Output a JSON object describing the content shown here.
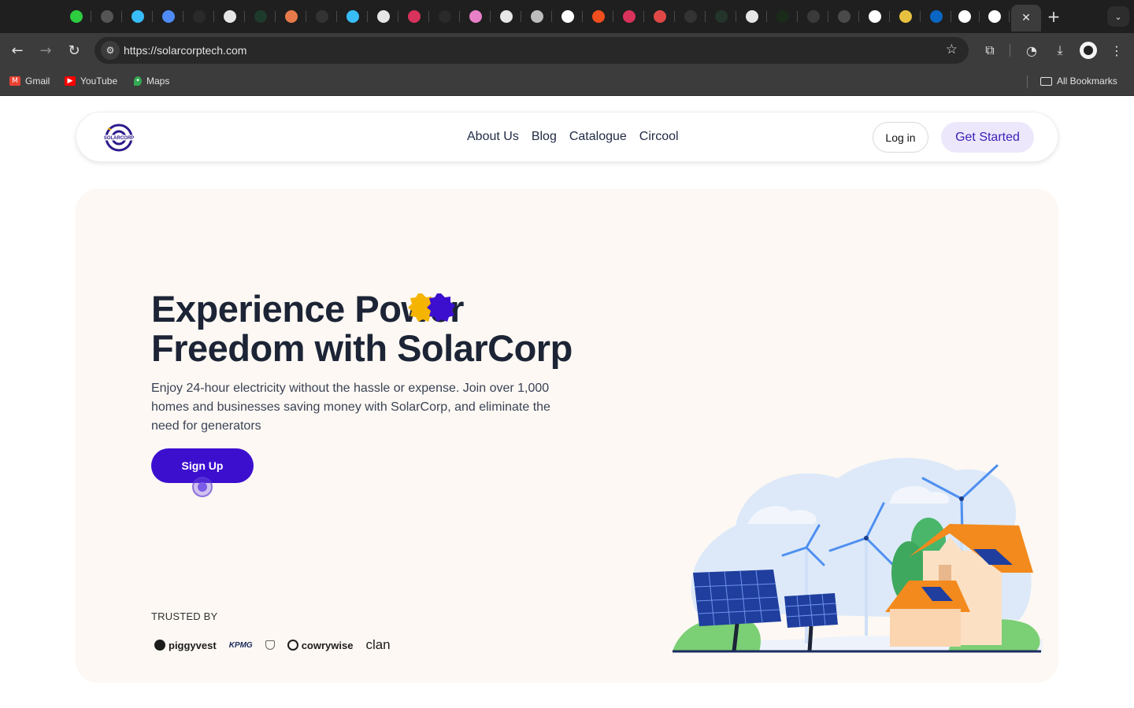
{
  "browser": {
    "tabs": [
      {
        "icon": "green-circle-icon",
        "color": "#2ecc40"
      },
      {
        "icon": "slash-circle-icon",
        "color": "#555555"
      },
      {
        "icon": "tailwind-icon",
        "color": "#38bdf8"
      },
      {
        "icon": "sparkle-icon",
        "color": "#4f8cf7"
      },
      {
        "icon": "blank-tab-icon",
        "color": "#2a2a2a"
      },
      {
        "icon": "openai-icon",
        "color": "#e6e6e6"
      },
      {
        "icon": "cursor-app-icon",
        "color": "#1e3a2a"
      },
      {
        "icon": "claude-icon",
        "color": "#e67a4a"
      },
      {
        "icon": "slash-icon",
        "color": "#333333"
      },
      {
        "icon": "tailwind-icon",
        "color": "#38bdf8"
      },
      {
        "icon": "openai-icon",
        "color": "#e6e6e6"
      },
      {
        "icon": "debian-icon",
        "color": "#d7335c"
      },
      {
        "icon": "blank-tab-icon",
        "color": "#2a2a2a"
      },
      {
        "icon": "gradient-app-icon",
        "color": "#e880c8"
      },
      {
        "icon": "github-icon",
        "color": "#e6e6e6"
      },
      {
        "icon": "openai-icon",
        "color": "#bdbdbd"
      },
      {
        "icon": "google-icon",
        "color": "#ffffff"
      },
      {
        "icon": "figma-icon",
        "color": "#f24e1e"
      },
      {
        "icon": "debian-icon",
        "color": "#d7335c"
      },
      {
        "icon": "zb-icon",
        "color": "#e04848"
      },
      {
        "icon": "slash-icon",
        "color": "#333333"
      },
      {
        "icon": "blank-tab-icon",
        "color": "#23352b"
      },
      {
        "icon": "github-icon",
        "color": "#e6e6e6"
      },
      {
        "icon": "check-icon",
        "color": "#1a2b1a"
      },
      {
        "icon": "mlr-icon",
        "color": "#3a3a3a"
      },
      {
        "icon": "dots-icon",
        "color": "#4a4a4a"
      },
      {
        "icon": "avatar-tab-icon",
        "color": "#ffffff"
      },
      {
        "icon": "colorful-icon",
        "color": "#e8c040"
      },
      {
        "icon": "linkedin-icon",
        "color": "#0a66c2"
      },
      {
        "icon": "google-icon",
        "color": "#ffffff"
      },
      {
        "icon": "google-icon",
        "color": "#ffffff"
      }
    ],
    "active_tab_close": "✕",
    "new_tab": "+",
    "url": "https://solarcorptech.com",
    "bookmarks": [
      {
        "label": "Gmail",
        "icon": "gmail-icon",
        "color": "#ea4335"
      },
      {
        "label": "YouTube",
        "icon": "youtube-icon",
        "color": "#ff0000"
      },
      {
        "label": "Maps",
        "icon": "maps-icon",
        "color": "#34a853"
      }
    ],
    "all_bookmarks": "All Bookmarks"
  },
  "site": {
    "logo_text": "SOLARCORP",
    "nav": [
      "About Us",
      "Blog",
      "Catalogue",
      "Circool"
    ],
    "login": "Log in",
    "get_started": "Get Started",
    "headline_line1": "Experience Power",
    "headline_line2": "Freedom with SolarCorp",
    "subtext": "Enjoy 24-hour electricity without the hassle or expense. Join over 1,000 homes and businesses saving money with SolarCorp, and eliminate the need for generators",
    "signup": "Sign Up",
    "trusted_by": "TRUSTED BY",
    "partners": [
      "piggyvest",
      "KPMG",
      "cowrywise",
      "clan"
    ],
    "colors": {
      "primary": "#3c0fcf",
      "hero_bg": "#fdf8f3",
      "heading": "#1c2436",
      "accent_yellow": "#f5b400",
      "accent_orange": "#f38a1d"
    }
  }
}
